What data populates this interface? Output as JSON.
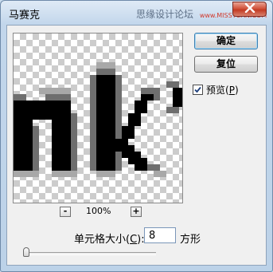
{
  "window": {
    "title": "马赛克",
    "watermark_cn": "思缘设计论坛",
    "watermark_url": "www.MISSYUAN.COM"
  },
  "buttons": {
    "ok_label": "确定",
    "reset_label": "复位"
  },
  "preview_option": {
    "label": "预览(",
    "hotkey": "P",
    "suffix": ")",
    "checked": true
  },
  "zoom": {
    "minus_label": "-",
    "plus_label": "+",
    "level": "100%"
  },
  "cell_size": {
    "label": "单元格大小(",
    "hotkey": "C",
    "suffix": "):",
    "value": "8",
    "unit": "方形",
    "slider_fraction": 0.0
  },
  "icons": {
    "close": "close-icon",
    "checkmark": "checkmark-icon"
  },
  "colors": {
    "close_button": "#c23a22",
    "mosaic_ink": "#000000",
    "mosaic_fringe": "#6e6e6e"
  }
}
